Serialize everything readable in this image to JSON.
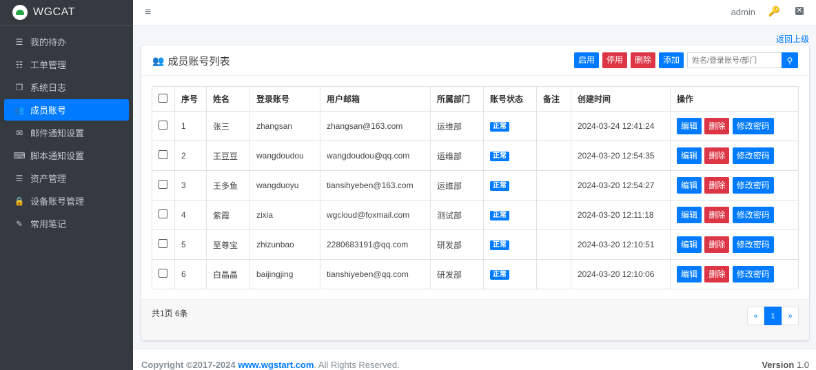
{
  "brand": {
    "name": "WGCAT"
  },
  "sidebar": {
    "items": [
      {
        "label": "我的待办",
        "icon": "server-icon",
        "glyph": "☰",
        "active": false
      },
      {
        "label": "工单管理",
        "icon": "list-icon",
        "glyph": "☷",
        "active": false
      },
      {
        "label": "系统日志",
        "icon": "clone-icon",
        "glyph": "❐",
        "active": false
      },
      {
        "label": "成员账号",
        "icon": "users-icon",
        "glyph": "👥",
        "active": true
      },
      {
        "label": "邮件通知设置",
        "icon": "envelope-icon",
        "glyph": "✉",
        "active": false
      },
      {
        "label": "脚本通知设置",
        "icon": "keyboard-icon",
        "glyph": "⌨",
        "active": false
      },
      {
        "label": "资产管理",
        "icon": "database-icon",
        "glyph": "☰",
        "active": false
      },
      {
        "label": "设备账号管理",
        "icon": "lock-icon",
        "glyph": "🔒",
        "active": false
      },
      {
        "label": "常用笔记",
        "icon": "edit-icon",
        "glyph": "✎",
        "active": false
      }
    ]
  },
  "topbar": {
    "menu_glyph": "≡",
    "user": "admin",
    "key_glyph": "🔑",
    "close_glyph": "✕"
  },
  "back_link": "返回上级",
  "card": {
    "title": "成员账号列表",
    "title_glyph": "👥",
    "buttons": {
      "enable": "启用",
      "disable": "停用",
      "delete": "删除",
      "add": "添加"
    },
    "search_placeholder": "姓名/登录账号/部门",
    "search_glyph": "⚲"
  },
  "table": {
    "headers": [
      "序号",
      "姓名",
      "登录账号",
      "用户邮箱",
      "所属部门",
      "账号状态",
      "备注",
      "创建时间",
      "操作"
    ],
    "rows": [
      {
        "no": "1",
        "name": "张三",
        "login": "zhangsan",
        "email": "zhangsan@163.com",
        "dept": "运维部",
        "status": "正常",
        "note": "",
        "created": "2024-03-24 12:41:24"
      },
      {
        "no": "2",
        "name": "王豆豆",
        "login": "wangdoudou",
        "email": "wangdoudou@qq.com",
        "dept": "运维部",
        "status": "正常",
        "note": "",
        "created": "2024-03-20 12:54:35"
      },
      {
        "no": "3",
        "name": "王多鱼",
        "login": "wangduoyu",
        "email": "tiansihyeben@163.com",
        "dept": "运维部",
        "status": "正常",
        "note": "",
        "created": "2024-03-20 12:54:27"
      },
      {
        "no": "4",
        "name": "紫霞",
        "login": "zixia",
        "email": "wgcloud@foxmail.com",
        "dept": "测试部",
        "status": "正常",
        "note": "",
        "created": "2024-03-20 12:11:18"
      },
      {
        "no": "5",
        "name": "至尊宝",
        "login": "zhizunbao",
        "email": "2280683191@qq.com",
        "dept": "研发部",
        "status": "正常",
        "note": "",
        "created": "2024-03-20 12:10:51"
      },
      {
        "no": "6",
        "name": "白晶晶",
        "login": "baijingjing",
        "email": "tianshiyeben@qq.com",
        "dept": "研发部",
        "status": "正常",
        "note": "",
        "created": "2024-03-20 12:10:06"
      }
    ],
    "actions": {
      "edit": "编辑",
      "delete": "删除",
      "password": "修改密码"
    }
  },
  "footer": {
    "count": "共1页 6条",
    "pager": {
      "prev": "«",
      "current": "1",
      "next": "»"
    }
  },
  "page_footer": {
    "copyright_prefix": "Copyright ©2017-2024 ",
    "site": "www.wgstart.com",
    "copyright_suffix": ". All Rights Reserved.",
    "version_label": "Version",
    "version": "1.0"
  }
}
